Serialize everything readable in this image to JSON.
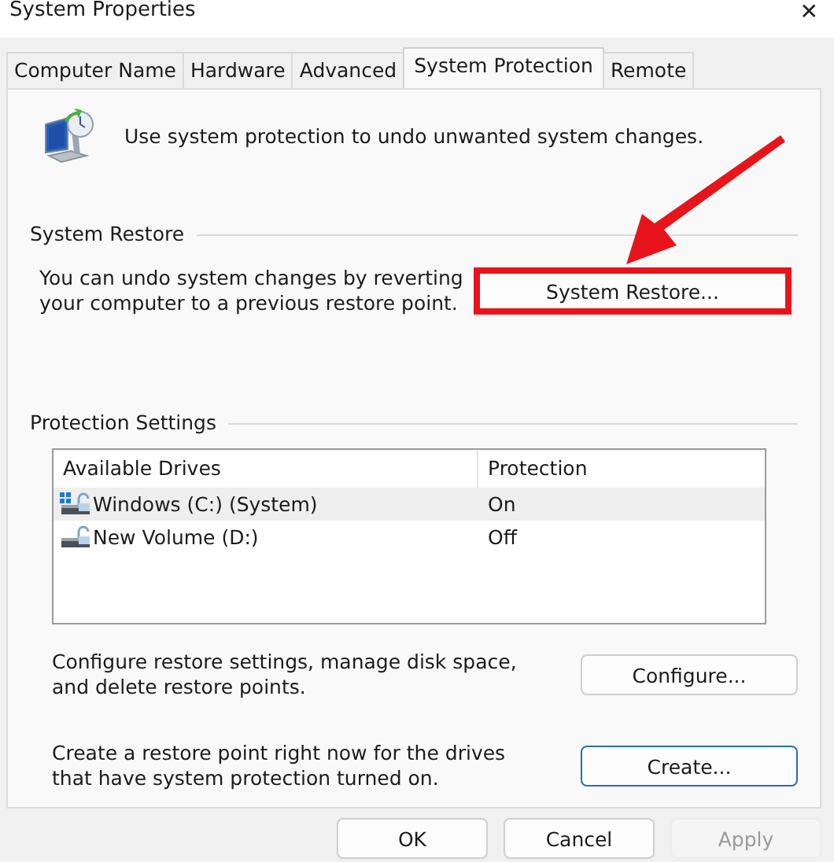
{
  "window": {
    "title": "System Properties",
    "close": "✕"
  },
  "tabs": [
    {
      "label": "Computer Name",
      "selected": false
    },
    {
      "label": "Hardware",
      "selected": false
    },
    {
      "label": "Advanced",
      "selected": false
    },
    {
      "label": "System Protection",
      "selected": true
    },
    {
      "label": "Remote",
      "selected": false
    }
  ],
  "intro": "Use system protection to undo unwanted system changes.",
  "system_restore": {
    "heading": "System Restore",
    "text": "You can undo system changes by reverting your computer to a previous restore point.",
    "button": {
      "label": "System Restore...",
      "highlighted": true
    }
  },
  "protection_settings": {
    "heading": "Protection Settings",
    "columns": [
      "Available Drives",
      "Protection"
    ],
    "rows": [
      {
        "drive": "Windows (C:) (System)",
        "protection": "On",
        "system": true,
        "selected": true
      },
      {
        "drive": "New Volume (D:)",
        "protection": "Off",
        "system": false,
        "selected": false
      }
    ],
    "actions": [
      {
        "text": "Configure restore settings, manage disk space, and delete restore points.",
        "button": "Configure...",
        "focused": false
      },
      {
        "text": "Create a restore point right now for the drives that have system protection turned on.",
        "button": "Create...",
        "focused": true
      }
    ]
  },
  "buttons": [
    {
      "label": "OK",
      "disabled": false
    },
    {
      "label": "Cancel",
      "disabled": false
    },
    {
      "label": "Apply",
      "disabled": true
    }
  ]
}
